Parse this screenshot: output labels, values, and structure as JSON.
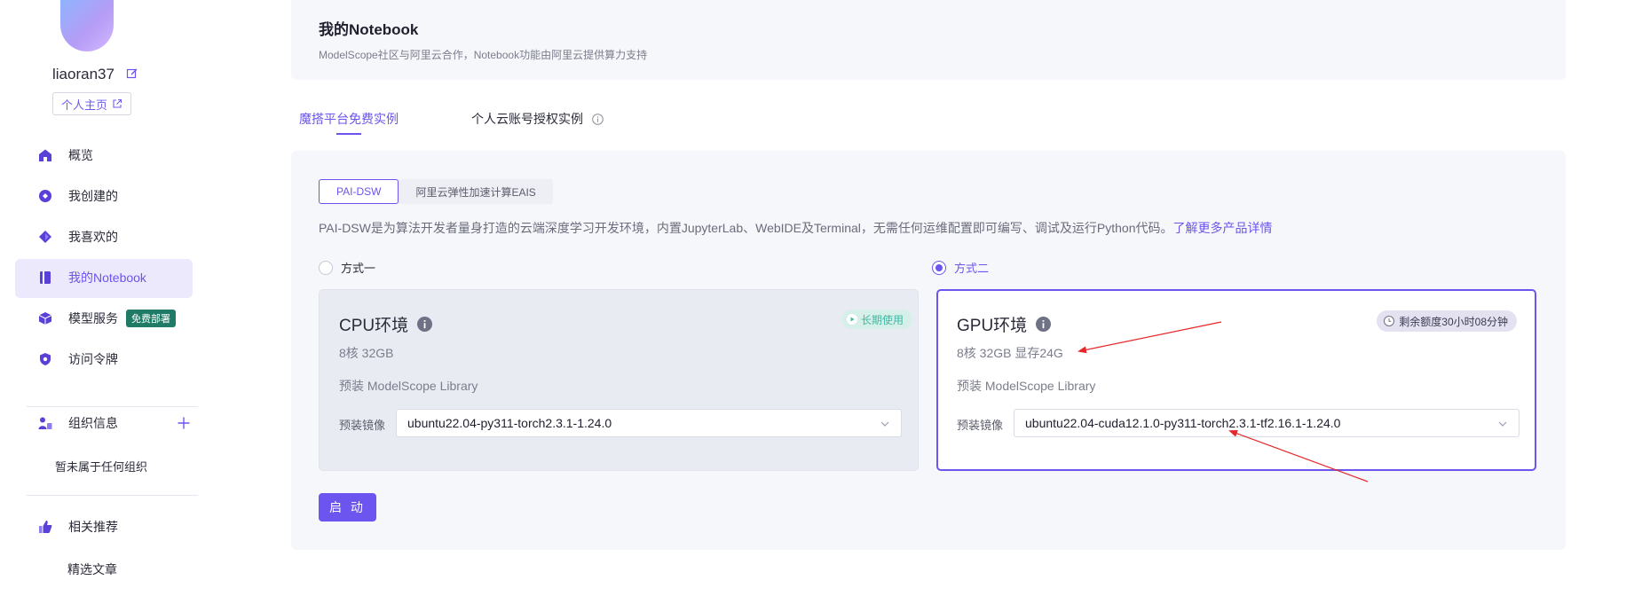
{
  "user": {
    "name": "liaoran37",
    "profile_link": "个人主页"
  },
  "sidebar": {
    "items": [
      {
        "label": "概览",
        "icon": "home-icon"
      },
      {
        "label": "我创建的",
        "icon": "create-icon"
      },
      {
        "label": "我喜欢的",
        "icon": "diamond-icon"
      },
      {
        "label": "我的Notebook",
        "icon": "notebook-icon",
        "active": true
      },
      {
        "label": "模型服务",
        "icon": "cube-icon",
        "badge": "免费部署"
      },
      {
        "label": "访问令牌",
        "icon": "shield-icon"
      }
    ],
    "org": {
      "label": "组织信息",
      "empty_text": "暂未属于任何组织"
    },
    "recommend": {
      "label": "相关推荐",
      "sub": "精选文章"
    }
  },
  "header": {
    "title": "我的Notebook",
    "subtitle": "ModelScope社区与阿里云合作，Notebook功能由阿里云提供算力支持"
  },
  "tabs": [
    {
      "label": "魔搭平台免费实例",
      "active": true
    },
    {
      "label": "个人云账号授权实例",
      "active": false
    }
  ],
  "subtabs": [
    {
      "label": "PAI-DSW",
      "active": true
    },
    {
      "label": "阿里云弹性加速计算EAIS",
      "active": false
    }
  ],
  "description": {
    "text": "PAI-DSW是为算法开发者量身打造的云端深度学习开发环境，内置JupyterLab、WebIDE及Terminal，无需任何运维配置即可编写、调试及运行Python代码。",
    "link": "了解更多产品详情"
  },
  "options": [
    {
      "radio_label": "方式一",
      "selected": false,
      "title": "CPU环境",
      "badge": "长期使用",
      "spec": "8核 32GB",
      "library": "预装 ModelScope Library",
      "image_label": "预装镜像",
      "image_value": "ubuntu22.04-py311-torch2.3.1-1.24.0"
    },
    {
      "radio_label": "方式二",
      "selected": true,
      "title": "GPU环境",
      "badge": "剩余额度30小时08分钟",
      "spec": "8核 32GB 显存24G",
      "library": "预装 ModelScope Library",
      "image_label": "预装镜像",
      "image_value": "ubuntu22.04-cuda12.1.0-py311-torch2.3.1-tf2.16.1-1.24.0"
    }
  ],
  "start_button": "启 动",
  "colors": {
    "accent": "#6b55ee",
    "annotation": "#e8262a",
    "badge_green": "#1f7a66"
  }
}
